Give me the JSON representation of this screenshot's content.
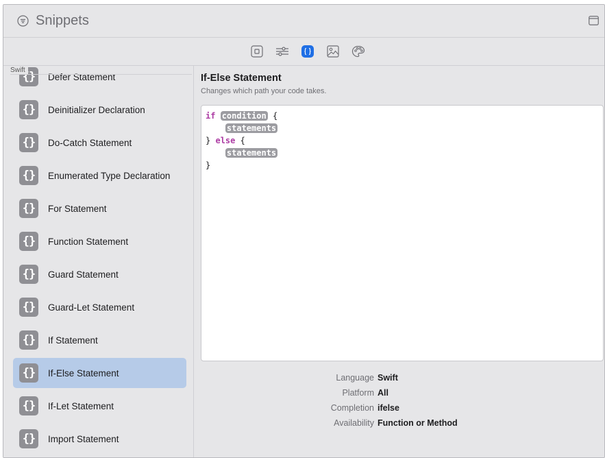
{
  "window": {
    "title": "Snippets"
  },
  "toolbar": {
    "buttons": [
      {
        "icon": "file-inspector-icon",
        "active": false
      },
      {
        "icon": "attributes-inspector-icon",
        "active": false
      },
      {
        "icon": "snippets-library-icon",
        "active": true
      },
      {
        "icon": "media-library-icon",
        "active": false
      },
      {
        "icon": "color-library-icon",
        "active": false
      }
    ]
  },
  "sidebar": {
    "header": "Swift",
    "items": [
      {
        "icon_text": "{}",
        "label": "Defer Statement",
        "selected": false
      },
      {
        "icon_text": "{}",
        "label": "Deinitializer Declaration",
        "selected": false
      },
      {
        "icon_text": "{}",
        "label": "Do-Catch Statement",
        "selected": false
      },
      {
        "icon_text": "{}",
        "label": "Enumerated Type Declaration",
        "selected": false
      },
      {
        "icon_text": "{}",
        "label": "For Statement",
        "selected": false
      },
      {
        "icon_text": "{}",
        "label": "Function Statement",
        "selected": false
      },
      {
        "icon_text": "{}",
        "label": "Guard Statement",
        "selected": false
      },
      {
        "icon_text": "{}",
        "label": "Guard-Let Statement",
        "selected": false
      },
      {
        "icon_text": "{}",
        "label": "If Statement",
        "selected": false
      },
      {
        "icon_text": "{}",
        "label": "If-Else Statement",
        "selected": true
      },
      {
        "icon_text": "{}",
        "label": "If-Let Statement",
        "selected": false
      },
      {
        "icon_text": "{}",
        "label": "Import Statement",
        "selected": false
      }
    ]
  },
  "detail": {
    "title": "If-Else Statement",
    "subtitle": "Changes which path your code takes.",
    "code": {
      "kw_if": "if",
      "ph_condition": "condition",
      "brace_open": "{",
      "ph_statements_1": "statements",
      "close_else": "}",
      "kw_else": "else",
      "brace_open_2": "{",
      "ph_statements_2": "statements",
      "brace_close": "}"
    },
    "meta": [
      {
        "key": "Language",
        "value": "Swift"
      },
      {
        "key": "Platform",
        "value": "All"
      },
      {
        "key": "Completion",
        "value": "ifelse"
      },
      {
        "key": "Availability",
        "value": "Function or Method"
      }
    ]
  },
  "colors": {
    "accent": "#1f6fe5",
    "selection": "#b6cbe8",
    "keyword": "#ad3da4",
    "placeholder": "#9c9ca1"
  }
}
